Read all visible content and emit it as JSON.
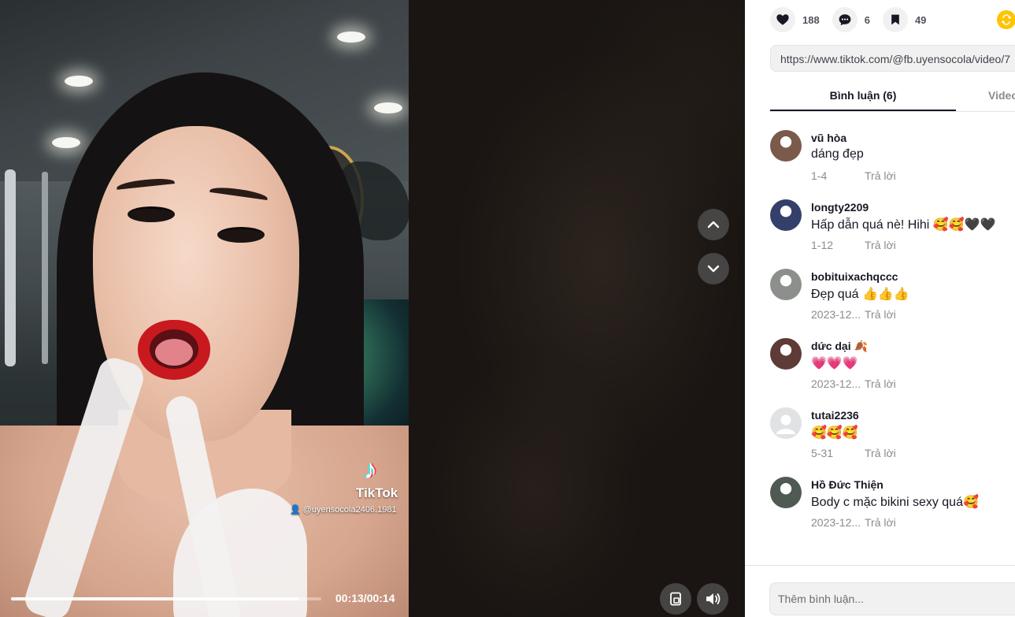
{
  "player": {
    "watermark_logo": "♪",
    "watermark_brand": "TikTok",
    "watermark_user": "@uyensocola2406.1981",
    "time_label": "00:13/00:14",
    "progress_fraction": 0.93,
    "nav_up_icon": "chevron-up-icon",
    "nav_down_icon": "chevron-down-icon",
    "pip_icon": "pip-icon",
    "volume_icon": "volume-icon"
  },
  "actions": {
    "likes": "188",
    "comments": "6",
    "saves": "49",
    "share_color": "#ffc300"
  },
  "share_link": {
    "value": "https://www.tiktok.com/@fb.uyensocola/video/7"
  },
  "tabs": {
    "comments_label": "Bình luận (6)",
    "videos_label": "Video"
  },
  "comments": [
    {
      "user": "vũ hòa",
      "text": "dáng đẹp",
      "date": "1-4",
      "reply": "Trả lời",
      "avatar_color": "#7a5a4a"
    },
    {
      "user": "longty2209",
      "text": "Hấp dẫn quá nè! Hihi 🥰🥰🖤🖤",
      "date": "1-12",
      "reply": "Trả lời",
      "avatar_color": "#35406a"
    },
    {
      "user": "bobituixachqccc",
      "text": "Đẹp quá 👍👍👍",
      "date": "2023-12...",
      "reply": "Trả lời",
      "avatar_color": "#8d8f8c"
    },
    {
      "user": "dức dại 🍂",
      "text": "💗💗💗",
      "date": "2023-12...",
      "reply": "Trả lời",
      "avatar_color": "#5e3b36"
    },
    {
      "user": "tutai2236",
      "text": "🥰🥰🥰",
      "date": "5-31",
      "reply": "Trả lời",
      "avatar_color": "#d7d8da"
    },
    {
      "user": "Hồ Đức Thiện",
      "text": "Body c mặc bikini sexy quá🥰",
      "date": "2023-12...",
      "reply": "Trả lời",
      "avatar_color": "#4f5a52"
    }
  ],
  "compose": {
    "placeholder": "Thêm bình luận..."
  }
}
